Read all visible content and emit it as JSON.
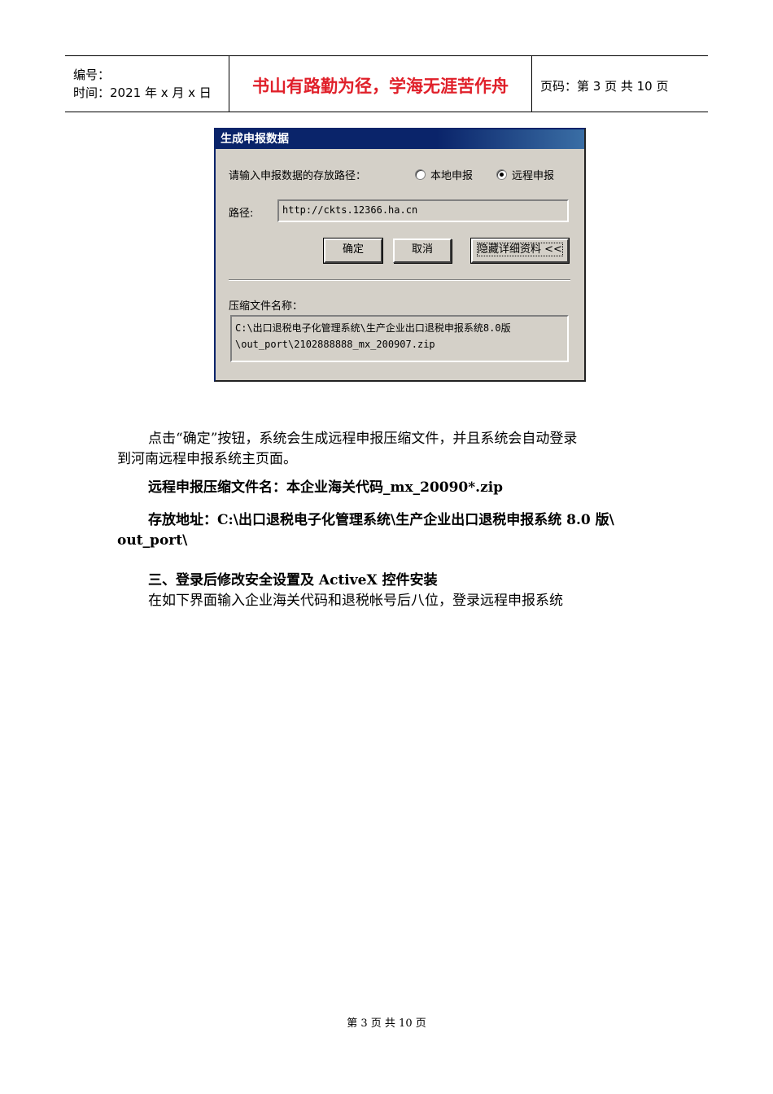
{
  "header": {
    "number_label": "编号：",
    "time_label": "时间：2021 年 x 月 x 日",
    "motto": "书山有路勤为径，学海无涯苦作舟",
    "page_info": "页码：第 3 页  共 10 页"
  },
  "dialog": {
    "title": "生成申报数据",
    "prompt": "请输入申报数据的存放路径：",
    "radio_local": "本地申报",
    "radio_remote": "远程申报",
    "path_label": "路径:",
    "path_value": "http://ckts.12366.ha.cn",
    "ok_label": "确定",
    "cancel_label": "取消",
    "hide_details_label": "隐藏详细资料 <<",
    "zip_label": "压缩文件名称：",
    "zip_line1": "C:\\出口退税电子化管理系统\\生产企业出口退税申报系统8.0版",
    "zip_line2": "\\out_port\\2102888888_mx_200907.zip"
  },
  "body": {
    "para1_line1": "点击“确定”按钮，系统会生成远程申报压缩文件，并且系统会自动登录",
    "para1_line2": "到河南远程申报系统主页面。",
    "zip_name": "远程申报压缩文件名：本企业海关代码_mx_20090*.zip",
    "store_line1": "存放地址：C:\\出口退税电子化管理系统\\生产企业出口退税申报系统 8.0 版\\",
    "store_line2": "out_port\\",
    "section3_heading": "三、登录后修改安全设置及 ActiveX 控件安装",
    "section3_text": "在如下界面输入企业海关代码和退税帐号后八位，登录远程申报系统"
  },
  "footer": {
    "page_text": "第 3 页 共 10 页"
  }
}
